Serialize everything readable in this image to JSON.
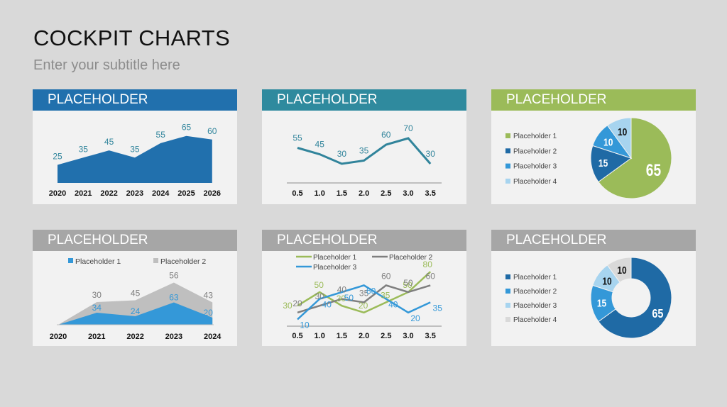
{
  "title": "COCKPIT CHARTS",
  "subtitle": "Enter your subtitle here",
  "colors": {
    "blue": "#2170ad",
    "teal": "#2f8a9e",
    "green": "#9bbb59",
    "gray": "#a6a6a6",
    "mid_blue": "#3498d8",
    "light_blue": "#a7d4ef",
    "dark_blue": "#1f6aa5",
    "light_gray": "#d9d9d9"
  },
  "chart_data": [
    {
      "type": "area",
      "title": "PLACEHOLDER",
      "header_color": "#2170ad",
      "categories": [
        "2020",
        "2021",
        "2022",
        "2023",
        "2024",
        "2025",
        "2026"
      ],
      "values": [
        25,
        35,
        45,
        35,
        55,
        65,
        60
      ],
      "color": "#2170ad",
      "label_color": "#31859c"
    },
    {
      "type": "line",
      "title": "PLACEHOLDER",
      "header_color": "#2f8a9e",
      "categories": [
        "0.5",
        "1.0",
        "1.5",
        "2.0",
        "2.5",
        "3.0",
        "3.5"
      ],
      "values": [
        55,
        45,
        30,
        35,
        60,
        70,
        30
      ],
      "color": "#31849b",
      "label_color": "#31849b"
    },
    {
      "type": "pie",
      "title": "PLACEHOLDER",
      "header_color": "#9bbb59",
      "series": [
        {
          "name": "Placeholder 1",
          "value": 65,
          "color": "#9bbb59",
          "label_color": "#ffffff"
        },
        {
          "name": "Placeholder 2",
          "value": 15,
          "color": "#1f6aa5",
          "label_color": "#ffffff"
        },
        {
          "name": "Placeholder 3",
          "value": 10,
          "color": "#3498d8",
          "label_color": "#ffffff"
        },
        {
          "name": "Placeholder 4",
          "value": 10,
          "color": "#a7d4ef",
          "label_color": "#111111"
        }
      ]
    },
    {
      "type": "area",
      "stacked": true,
      "title": "PLACEHOLDER",
      "header_color": "#a6a6a6",
      "legend": "top",
      "categories": [
        "2020",
        "2021",
        "2022",
        "2023",
        "2024"
      ],
      "series": [
        {
          "name": "Placeholder 1",
          "values": [
            0,
            34,
            24,
            63,
            20
          ],
          "color": "#3498d8"
        },
        {
          "name": "Placeholder 2",
          "values": [
            0,
            30,
            45,
            56,
            43
          ],
          "color": "#bfbfbf",
          "label_color": "#7f7f7f"
        }
      ]
    },
    {
      "type": "line",
      "title": "PLACEHOLDER",
      "header_color": "#a6a6a6",
      "legend": "top",
      "categories": [
        "0.5",
        "1.0",
        "1.5",
        "2.0",
        "2.5",
        "3.0",
        "3.5"
      ],
      "series": [
        {
          "name": "Placeholder 1",
          "values": [
            30,
            50,
            30,
            20,
            35,
            50,
            80
          ],
          "color": "#9bbb59"
        },
        {
          "name": "Placeholder 2",
          "values": [
            20,
            30,
            40,
            35,
            60,
            50,
            60
          ],
          "color": "#7f7f7f"
        },
        {
          "name": "Placeholder 3",
          "values": [
            10,
            40,
            50,
            60,
            40,
            20,
            35
          ],
          "color": "#3498d8"
        }
      ]
    },
    {
      "type": "pie",
      "donut": true,
      "title": "PLACEHOLDER",
      "header_color": "#a6a6a6",
      "series": [
        {
          "name": "Placeholder 1",
          "value": 65,
          "color": "#1f6aa5",
          "label_color": "#ffffff"
        },
        {
          "name": "Placeholder 2",
          "value": 15,
          "color": "#3498d8",
          "label_color": "#ffffff"
        },
        {
          "name": "Placeholder 3",
          "value": 10,
          "color": "#a7d4ef",
          "label_color": "#111111"
        },
        {
          "name": "Placeholder 4",
          "value": 10,
          "color": "#d9d9d9",
          "label_color": "#111111"
        }
      ]
    }
  ]
}
